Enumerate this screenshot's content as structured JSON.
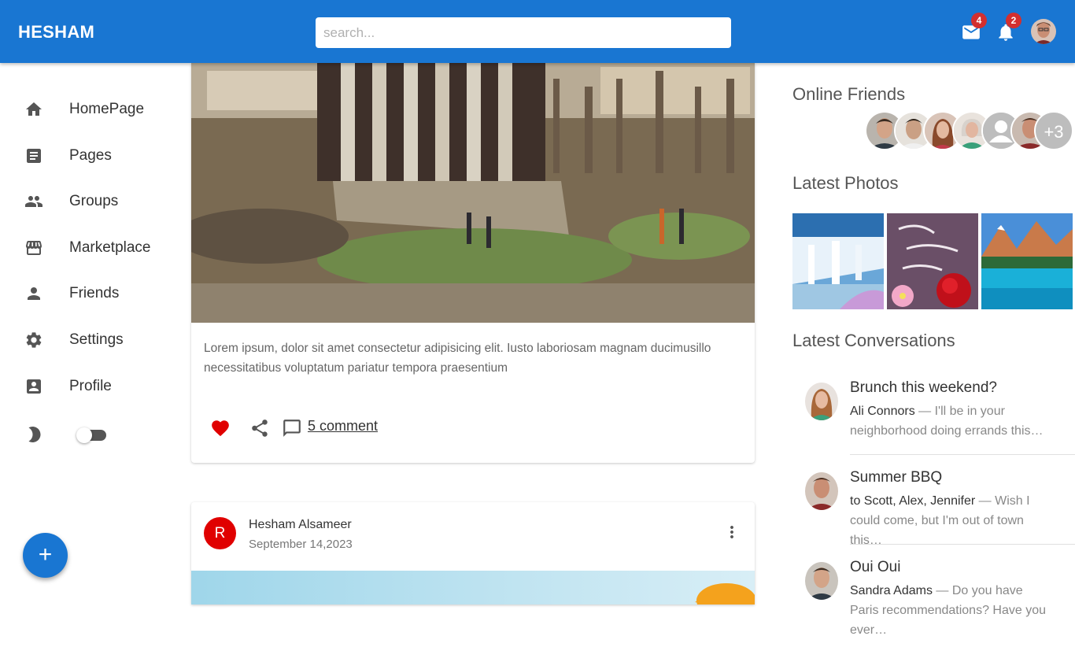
{
  "app": {
    "brand": "HESHAM"
  },
  "search": {
    "placeholder": "search..."
  },
  "header": {
    "mail": {
      "icon": "mail-icon",
      "count": "4"
    },
    "notifications": {
      "icon": "bell-icon",
      "count": "2"
    }
  },
  "sidebar": {
    "items": [
      {
        "label": "HomePage",
        "icon": "home-icon"
      },
      {
        "label": "Pages",
        "icon": "article-icon"
      },
      {
        "label": "Groups",
        "icon": "group-icon"
      },
      {
        "label": "Marketplace",
        "icon": "storefront-icon"
      },
      {
        "label": "Friends",
        "icon": "person-icon"
      },
      {
        "label": "Settings",
        "icon": "gear-icon"
      },
      {
        "label": "Profile",
        "icon": "account-box-icon"
      }
    ],
    "fab_label": "+"
  },
  "feed": {
    "post1": {
      "text": "Lorem ipsum, dolor sit amet consectetur adipisicing elit. Iusto laboriosam magnam ducimusillo necessitatibus voluptatum pariatur tempora praesentium",
      "comments": "5 comment"
    },
    "post2": {
      "avatar_letter": "R",
      "author": "Hesham Alsameer",
      "date": "September 14,2023"
    }
  },
  "right": {
    "online_title": "Online Friends",
    "more_friends": "+3",
    "photos_title": "Latest Photos",
    "conversations_title": "Latest Conversations",
    "conversations": [
      {
        "title": "Brunch this weekend?",
        "sender": "Ali Connors",
        "preview": " — I'll be in your neighborhood doing errands this…"
      },
      {
        "title": "Summer BBQ",
        "sender": "to Scott, Alex, Jennifer",
        "preview": " — Wish I could come, but I'm out of town this…"
      },
      {
        "title": "Oui Oui",
        "sender": "Sandra Adams",
        "preview": " — Do you have Paris recommendations? Have you ever…"
      }
    ]
  },
  "colors": {
    "appbar": "#1976d2",
    "badge": "#d32f2f",
    "heart": "#e00000"
  }
}
